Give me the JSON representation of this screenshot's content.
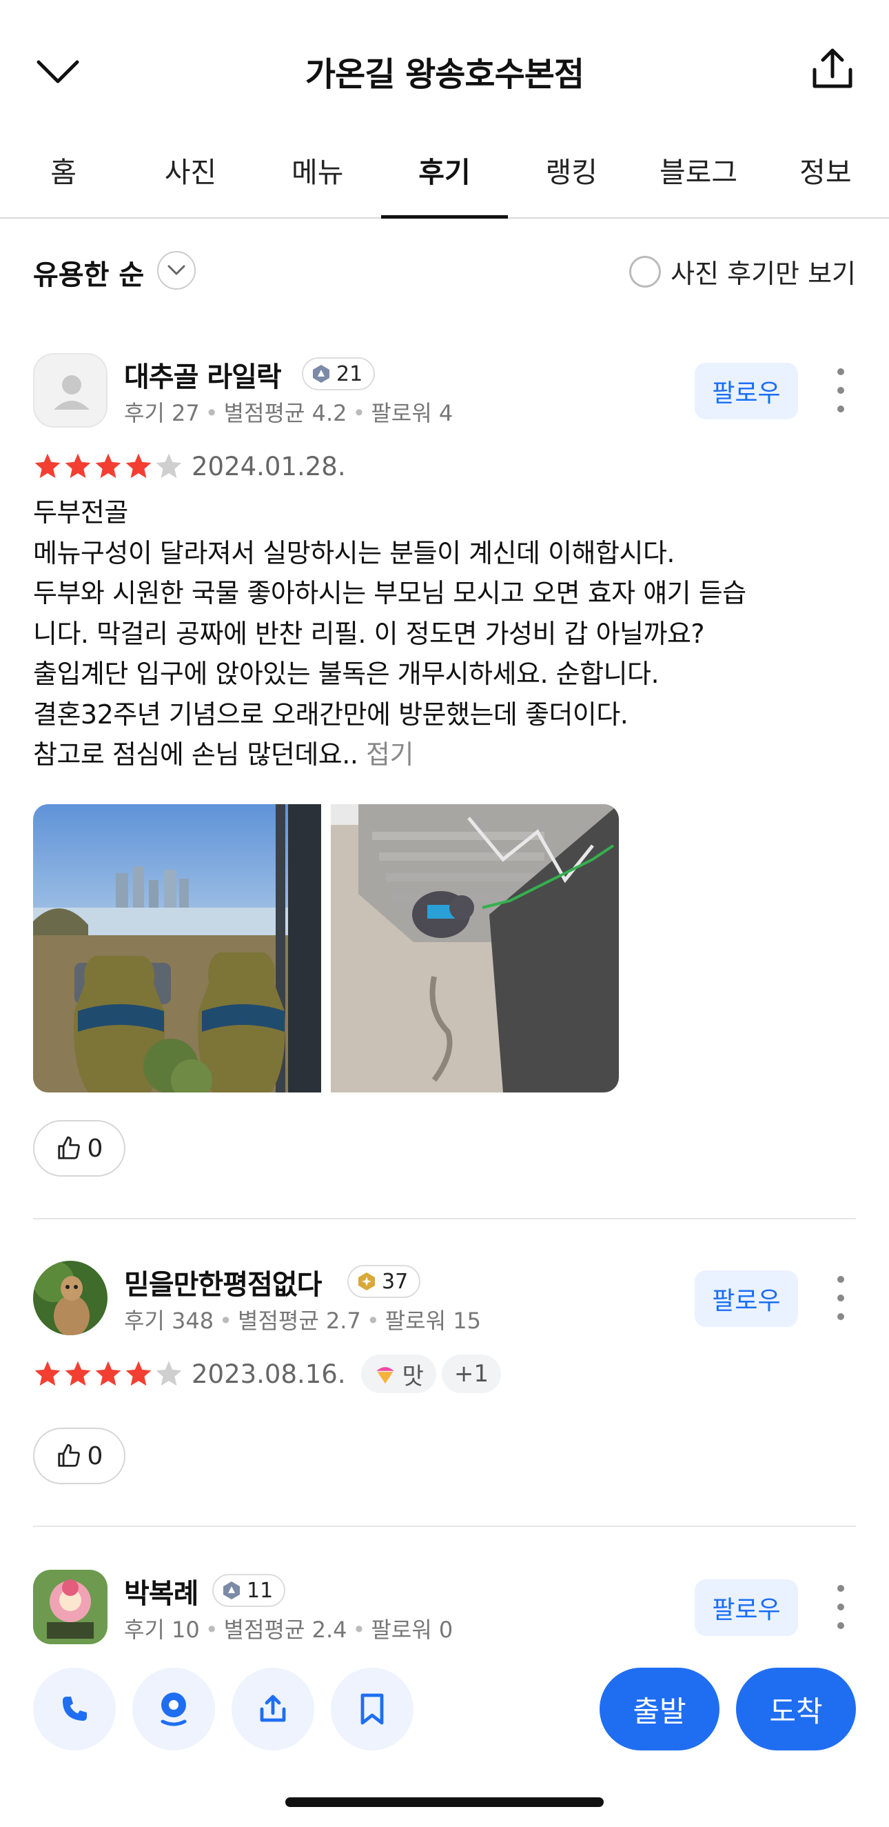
{
  "header": {
    "title": "가온길 왕송호수본점",
    "back_icon": "chevron-down-icon",
    "share_icon": "share-icon"
  },
  "tabs": [
    {
      "label": "홈",
      "active": false
    },
    {
      "label": "사진",
      "active": false
    },
    {
      "label": "메뉴",
      "active": false
    },
    {
      "label": "후기",
      "active": true
    },
    {
      "label": "랭킹",
      "active": false
    },
    {
      "label": "블로그",
      "active": false
    },
    {
      "label": "정보",
      "active": false
    }
  ],
  "sort": {
    "label": "유용한 순",
    "photo_only_label": "사진 후기만 보기",
    "photo_only_checked": false
  },
  "reviews": [
    {
      "name": "대추골 라일락",
      "level": "21",
      "meta": {
        "reviews": "후기 27",
        "avg": "별점평균 4.2",
        "followers": "팔로워 4"
      },
      "follow_label": "팔로우",
      "rating": 4,
      "date": "2024.01.28.",
      "text_lines": [
        "두부전골",
        "메뉴구성이 달라져서 실망하시는 분들이 계신데 이해합시다.",
        "두부와 시원한 국물 좋아하시는 부모님 모시고 오면 효자 얘기 듣습",
        "니다. 막걸리 공짜에 반찬 리필. 이 정도면 가성비 갑 아닐까요?",
        "출입계단 입구에 앉아있는 불독은 개무시하세요. 순합니다.",
        "결혼32주년 기념으로 오래간만에 방문했는데 좋더이다.",
        "참고로 점심에 손님 많던데요.."
      ],
      "fold_label": "접기",
      "likes": "0"
    },
    {
      "name": "믿을만한평점없다",
      "level": "37",
      "meta": {
        "reviews": "후기 348",
        "avg": "별점평균 2.7",
        "followers": "팔로워 15"
      },
      "follow_label": "팔로우",
      "rating": 4,
      "date": "2023.08.16.",
      "tags": [
        "맛",
        "+1"
      ],
      "likes": "0"
    },
    {
      "name": "박복례",
      "level": "11",
      "meta": {
        "reviews": "후기 10",
        "avg": "별점평균 2.4",
        "followers": "팔로워 0"
      },
      "follow_label": "팔로우"
    }
  ],
  "bottom": {
    "call_icon": "phone-icon",
    "location_icon": "location-pin-icon",
    "share_icon": "share-icon",
    "save_icon": "bookmark-icon",
    "depart_label": "출발",
    "arrive_label": "도착"
  },
  "colors": {
    "accent": "#1f6ef2",
    "star": "#f23f32",
    "follow_bg": "#eaf2ff"
  }
}
